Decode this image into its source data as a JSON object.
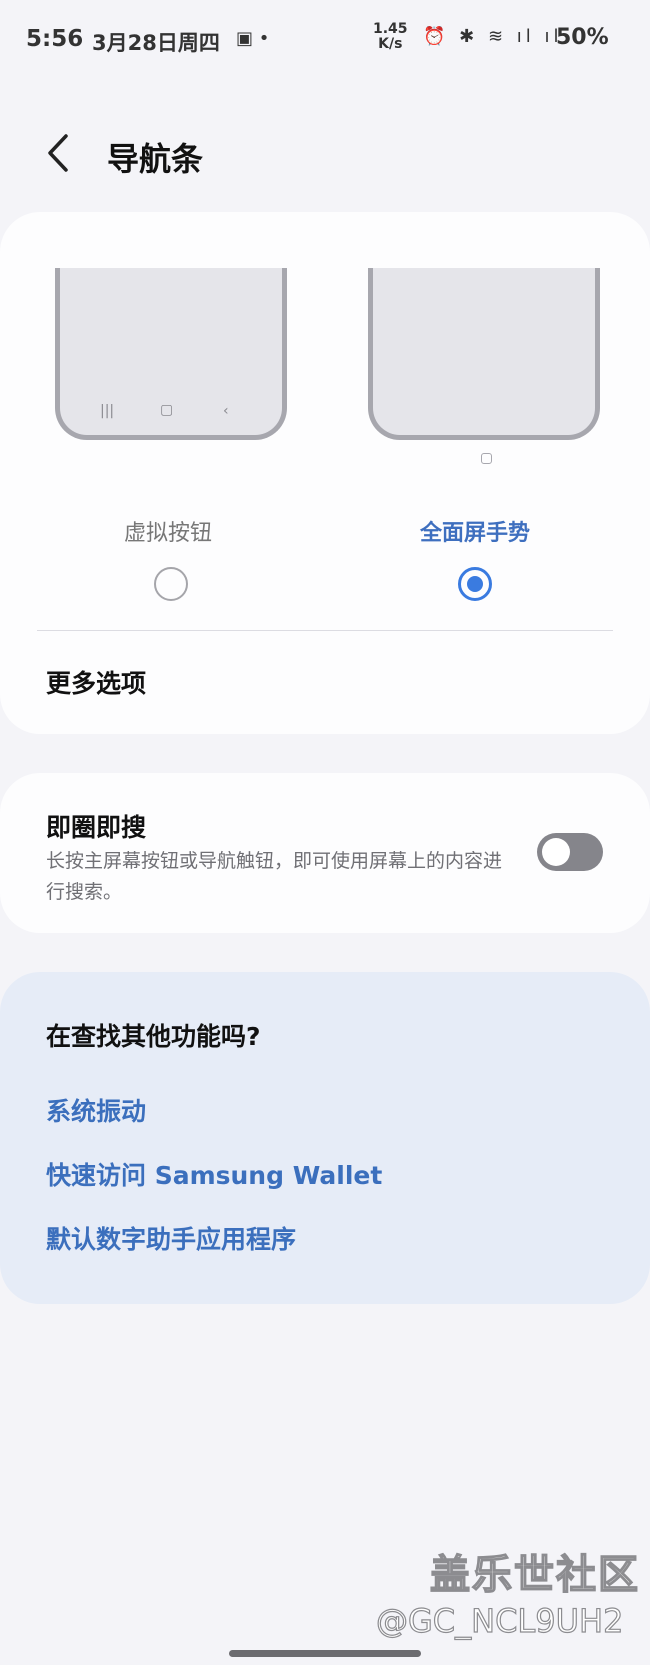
{
  "status_bar": {
    "time": "5:56",
    "date": "3月28日周四",
    "notif_icons": "▣ •",
    "net_speed_value": "1.45",
    "net_speed_unit": "K/s",
    "right_icons": "⏰ ✱ ≋ ıl ıl",
    "battery": "50%"
  },
  "header": {
    "title": "导航条"
  },
  "navigation_type": {
    "option_buttons": {
      "label": "虚拟按钮",
      "selected": false
    },
    "option_gestures": {
      "label": "全面屏手势",
      "selected": true
    },
    "more_options": "更多选项"
  },
  "circle_to_search": {
    "title": "即圈即搜",
    "description": "长按主屏幕按钮或导航触钮，即可使用屏幕上的内容进行搜索。",
    "enabled": false
  },
  "suggestions": {
    "title": "在查找其他功能吗?",
    "links": [
      "系统振动",
      "快速访问 Samsung Wallet",
      "默认数字助手应用程序"
    ]
  },
  "watermark": {
    "site": "盖乐世社区",
    "user": "@GC_NCL9UH2"
  },
  "colors": {
    "accent": "#3a7be0",
    "link": "#3b6fbd",
    "card_highlight": "#e6ecf7"
  }
}
